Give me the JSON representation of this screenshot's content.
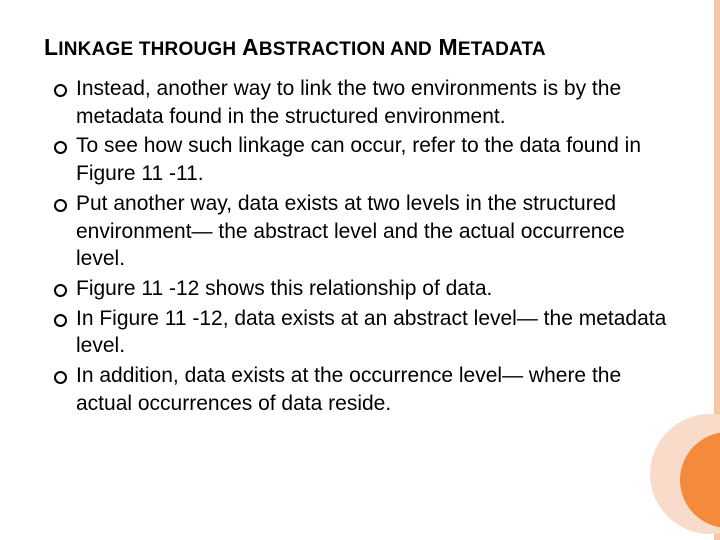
{
  "title_parts": {
    "p1": "L",
    "p2": "INKAGE ",
    "p3": "THROUGH",
    "p4": " A",
    "p5": "BSTRACTION ",
    "p6": "AND",
    "p7": " M",
    "p8": "ETADATA"
  },
  "bullets": [
    "Instead, another way to link the two environments is by the metadata found in the structured environment.",
    "To see how such linkage can occur, refer to the data found in Figure 11 -11.",
    "Put another way, data exists at two levels in the structured environment— the abstract level and the actual occurrence level.",
    "Figure 11 -12 shows this relationship of data.",
    "In Figure 11 -12, data exists at an abstract level— the metadata level.",
    "In addition, data exists at the occurrence level— where the actual occurrences of data reside."
  ],
  "theme": {
    "accent": "#f58a3c",
    "accent_light": "#f8dcc9",
    "bar": "#f5c9a8"
  }
}
